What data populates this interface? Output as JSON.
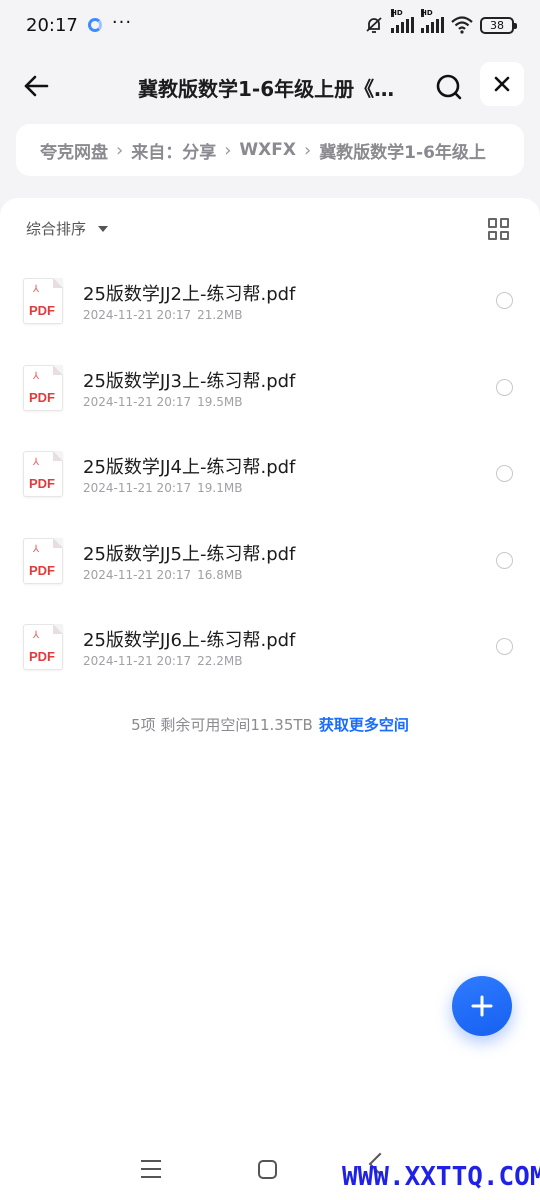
{
  "status_bar": {
    "time": "20:17",
    "dots": "···",
    "signal_labels": [
      "HD",
      "HD"
    ],
    "battery": "38"
  },
  "nav": {
    "title": "冀教版数学1-6年级上册《…"
  },
  "breadcrumb": {
    "items": [
      "夸克网盘",
      "来自：分享",
      "WXFX",
      "冀教版数学1-6年级上"
    ],
    "separator": "›"
  },
  "toolbar": {
    "sort_label": "综合排序"
  },
  "files": [
    {
      "name": "25版数学JJ2上-练习帮.pdf",
      "date": "2024-11-21 20:17",
      "size": "21.2MB",
      "type_label": "PDF"
    },
    {
      "name": "25版数学JJ3上-练习帮.pdf",
      "date": "2024-11-21 20:17",
      "size": "19.5MB",
      "type_label": "PDF"
    },
    {
      "name": "25版数学JJ4上-练习帮.pdf",
      "date": "2024-11-21 20:17",
      "size": "19.1MB",
      "type_label": "PDF"
    },
    {
      "name": "25版数学JJ5上-练习帮.pdf",
      "date": "2024-11-21 20:17",
      "size": "16.8MB",
      "type_label": "PDF"
    },
    {
      "name": "25版数学JJ6上-练习帮.pdf",
      "date": "2024-11-21 20:17",
      "size": "22.2MB",
      "type_label": "PDF"
    }
  ],
  "summary": {
    "text": "5项 剩余可用空间11.35TB",
    "link": "获取更多空间"
  },
  "watermark": "WWW.XXTTQ.COM",
  "icons": {
    "back": "arrow-left-icon",
    "search": "search-icon",
    "close": "close-icon",
    "sort": "caret-down-icon",
    "grid": "grid-view-icon",
    "add": "plus-icon"
  },
  "colors": {
    "accent": "#1a6cff",
    "pdf_red": "#e03c3c",
    "background": "#f4f4f6"
  }
}
